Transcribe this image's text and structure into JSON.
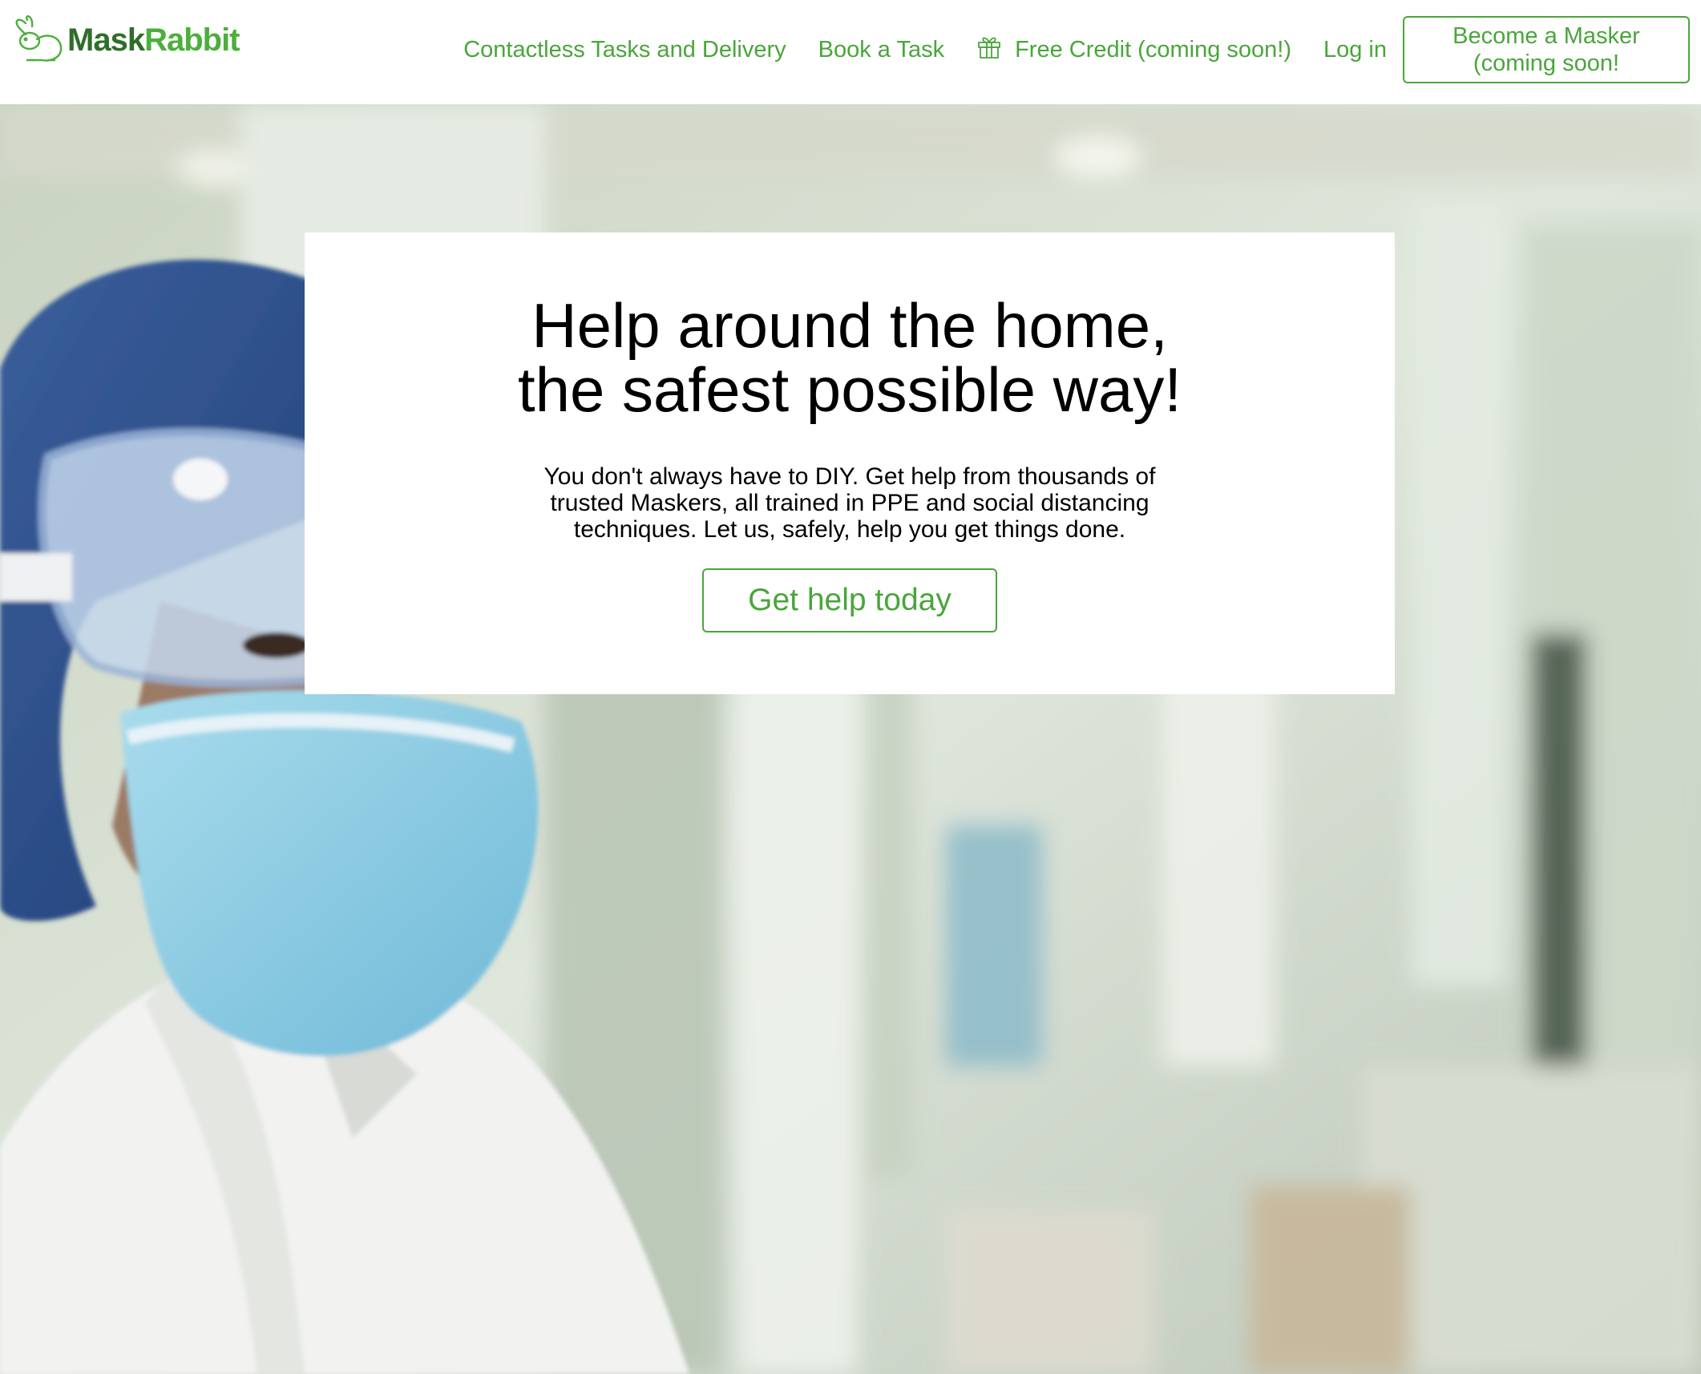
{
  "brand": {
    "name_part1": "Mask",
    "name_part2": "Rabbit",
    "colors": {
      "primary_green": "#4aa53b",
      "dark_green": "#2f6e2a"
    }
  },
  "nav": {
    "links": [
      {
        "label": "Contactless Tasks and Delivery"
      },
      {
        "label": "Book a Task"
      },
      {
        "label": "Free Credit (coming soon!)",
        "icon": "gift-icon"
      },
      {
        "label": "Log in"
      }
    ],
    "become_button": {
      "line1": "Become a Masker",
      "line2": "(coming soon!"
    }
  },
  "hero": {
    "headline_line1": "Help around the home,",
    "headline_line2": "the safest possible way!",
    "subtext_line1": "You don't always have to DIY. Get help from thousands of",
    "subtext_line2": "trusted Maskers, all trained in PPE and social distancing",
    "subtext_line3": "techniques. Let us, safely, help you get things done.",
    "cta_label": "Get help today",
    "background_image": "photo of a medical worker wearing a blue surgical cap, safety goggles, a blue face mask and a white coat in a bright hospital corridor"
  }
}
